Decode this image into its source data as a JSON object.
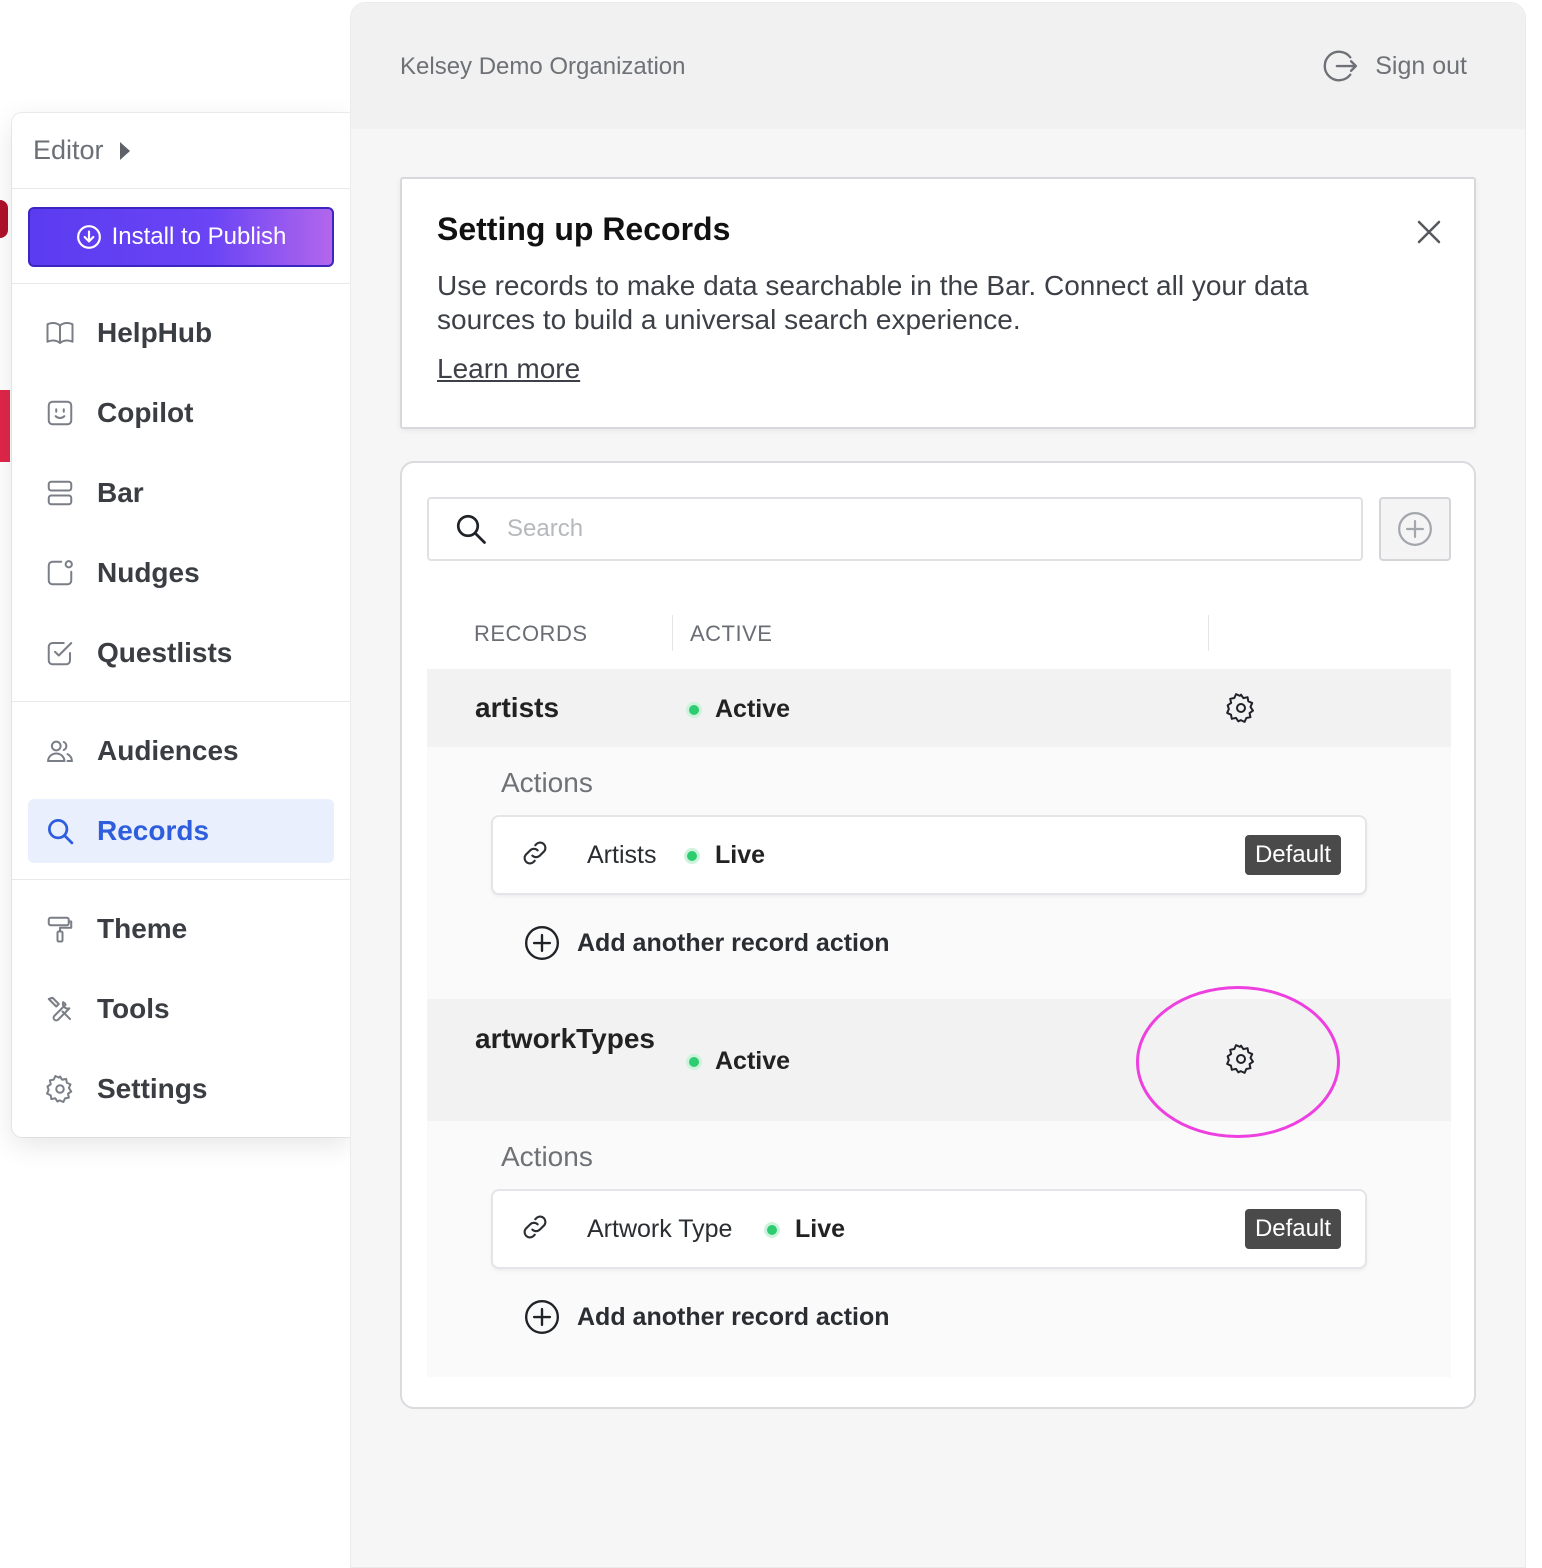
{
  "sidebar": {
    "editor_label": "Editor",
    "install_label": "Install to Publish",
    "groups": [
      [
        {
          "label": "HelpHub",
          "icon": "book-icon"
        },
        {
          "label": "Copilot",
          "icon": "copilot-icon"
        },
        {
          "label": "Bar",
          "icon": "bar-icon"
        },
        {
          "label": "Nudges",
          "icon": "nudge-icon"
        },
        {
          "label": "Questlists",
          "icon": "checklist-icon"
        }
      ],
      [
        {
          "label": "Audiences",
          "icon": "users-icon"
        },
        {
          "label": "Records",
          "icon": "search-icon",
          "active": true
        }
      ],
      [
        {
          "label": "Theme",
          "icon": "paint-roller-icon"
        },
        {
          "label": "Tools",
          "icon": "tools-icon"
        },
        {
          "label": "Settings",
          "icon": "gear-icon"
        }
      ]
    ]
  },
  "header": {
    "org_name": "Kelsey Demo Organization",
    "sign_out": "Sign out"
  },
  "info": {
    "title": "Setting up Records",
    "body": "Use records to make data searchable in the Bar. Connect all your data sources to build a universal search experience.",
    "link": "Learn more"
  },
  "records": {
    "search_placeholder": "Search",
    "columns": [
      "RECORDS",
      "ACTIVE"
    ],
    "actions_label": "Actions",
    "add_action_label": "Add another record action",
    "items": [
      {
        "name": "artists",
        "status": "Active",
        "actions": [
          {
            "name": "Artists",
            "status": "Live",
            "badge": "Default"
          }
        ]
      },
      {
        "name": "artworkTypes",
        "status": "Active",
        "actions": [
          {
            "name": "Artwork Type",
            "status": "Live",
            "badge": "Default"
          }
        ]
      }
    ]
  },
  "colors": {
    "accent": "#2e5ede",
    "install_gradient_start": "#5b3cf0",
    "install_gradient_end": "#b266ec",
    "status_green": "#2ecc71",
    "highlight_ring": "#ee3fe0"
  }
}
